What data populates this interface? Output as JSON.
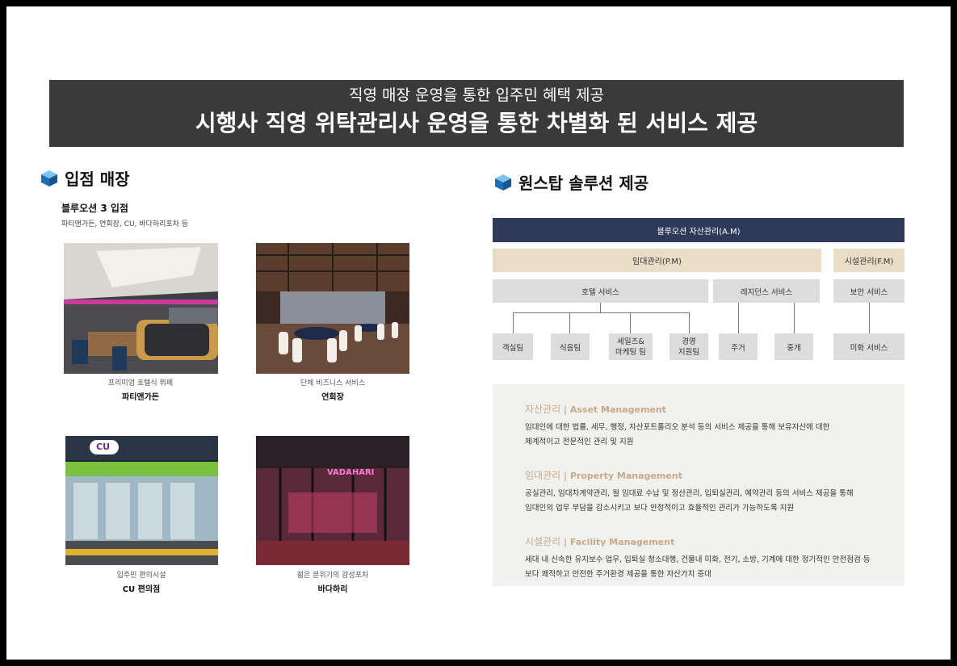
{
  "banner": {
    "subtitle": "직영 매장 운영을 통한 입주민 혜택 제공",
    "title": "시행사 직영 위탁관리사 운영을 통한 차별화 된 서비스 제공"
  },
  "left_section": {
    "title": "입점 매장",
    "store_heading": "블루오션 3 입점",
    "store_desc": "파티앤가든, 연회장, CU, 바다하리포차 등",
    "photos": [
      {
        "caption_sub": "프리미엄 호텔식 뷔페",
        "caption_name": "파티앤가든"
      },
      {
        "caption_sub": "단체 비즈니스 서비스",
        "caption_name": "연회장"
      },
      {
        "caption_sub": "입주민 편의시설",
        "caption_name": "CU 편의점"
      },
      {
        "caption_sub": "젊은 분위기의 감성포차",
        "caption_name": "바다하리"
      }
    ],
    "cu_sign": "CU",
    "bar_sign": "VADAHARI"
  },
  "right_section": {
    "title": "원스탑 솔루션 제공",
    "org": {
      "top": "블루오션 자산관리(A.M)",
      "lease": "임대관리(P.M)",
      "facility": "시설관리(F.M)",
      "hotel": "호텔 서비스",
      "residence": "레지던스 서비스",
      "security": "보안 서비스",
      "leaves": [
        "객실팀",
        "식음팀",
        "세일즈&\n마케팅 팀",
        "경영\n지원팀",
        "주거",
        "중개",
        "미화 서비스"
      ]
    },
    "management": [
      {
        "ko": "자산관리",
        "en": "Asset Management",
        "lines": [
          "임대인에 대한 법률, 세무, 행정, 자산포트폴리오 분석 등의 서비스 제공을 통해 보유자산에 대한",
          "체계적이고 전문적인 관리 및 지원"
        ]
      },
      {
        "ko": "임대관리",
        "en": "Property Management",
        "lines": [
          "공실관리, 임대차계약관리, 월 임대료 수납 및 정산관리, 입퇴실관리, 예약관리 등의 서비스 제공을 통해",
          "임대인의 업무 부담을 감소시키고 보다 안정적이고 효율적인 관리가 가능하도록 지원"
        ]
      },
      {
        "ko": "시설관리",
        "en": "Facility Management",
        "lines": [
          "세대 내 신속한 유지보수 업무, 입퇴실 청소대행, 건물내 미화, 전기, 소방, 기계에 대한 정기적인 안전점검 등",
          "보다 쾌적하고 안전한 주거환경 제공을 통한 자산가치 증대"
        ]
      }
    ],
    "separator": "|"
  }
}
